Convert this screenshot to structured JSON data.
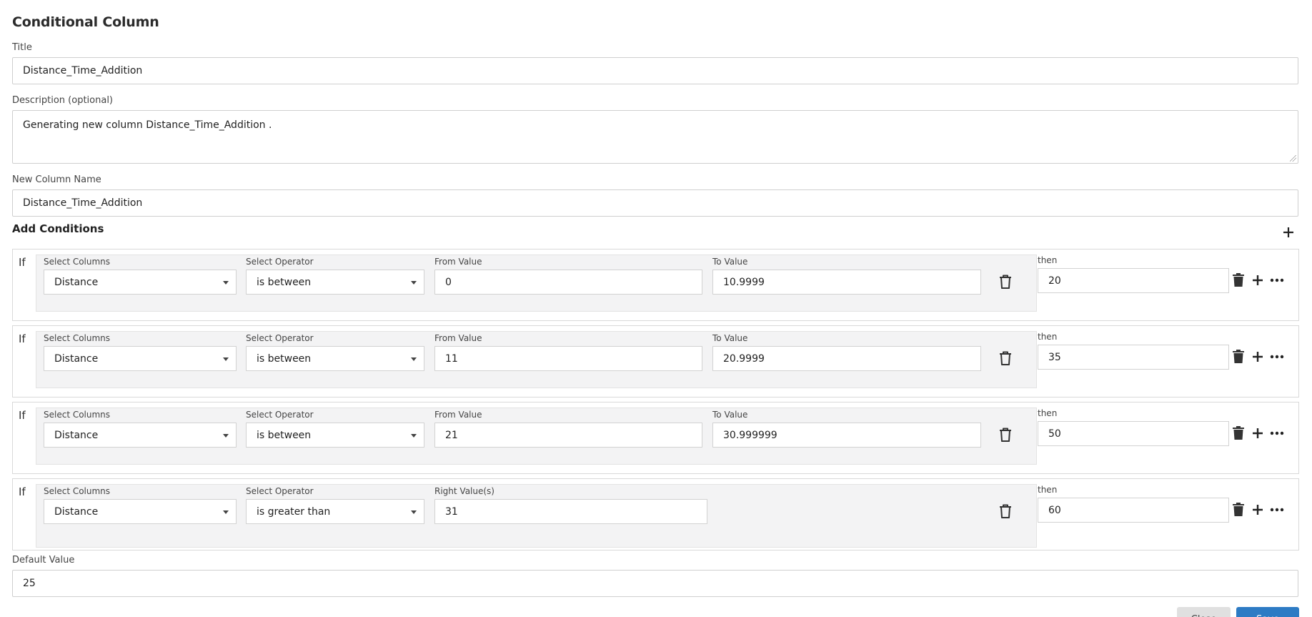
{
  "dialog": {
    "title": "Conditional Column",
    "title_label": "Title",
    "title_value": "Distance_Time_Addition",
    "description_label": "Description (optional)",
    "description_value": "Generating new column Distance_Time_Addition .",
    "new_column_label": "New Column Name",
    "new_column_value": "Distance_Time_Addition",
    "add_conditions_label": "Add Conditions",
    "default_value_label": "Default Value",
    "default_value": "25",
    "close_label": "Close",
    "save_label": "Save"
  },
  "conditions": [
    {
      "if_label": "If",
      "select_columns_label": "Select Columns",
      "column": "Distance",
      "select_operator_label": "Select Operator",
      "operator": "is between",
      "from_label": "From Value",
      "from_value": "0",
      "to_label": "To Value",
      "to_value": "10.9999",
      "then_label": "then",
      "then_value": "20"
    },
    {
      "if_label": "If",
      "select_columns_label": "Select Columns",
      "column": "Distance",
      "select_operator_label": "Select Operator",
      "operator": "is between",
      "from_label": "From Value",
      "from_value": "11",
      "to_label": "To Value",
      "to_value": "20.9999",
      "then_label": "then",
      "then_value": "35"
    },
    {
      "if_label": "If",
      "select_columns_label": "Select Columns",
      "column": "Distance",
      "select_operator_label": "Select Operator",
      "operator": "is between",
      "from_label": "From Value",
      "from_value": "21",
      "to_label": "To Value",
      "to_value": "30.999999",
      "then_label": "then",
      "then_value": "50"
    },
    {
      "if_label": "If",
      "select_columns_label": "Select Columns",
      "column": "Distance",
      "select_operator_label": "Select Operator",
      "operator": "is greater than",
      "right_label": "Right Value(s)",
      "right_value": "31",
      "then_label": "then",
      "then_value": "60"
    }
  ],
  "icons": {
    "add": "plus-icon",
    "delete_condition": "trash-outline-icon",
    "delete_row": "trash-solid-icon",
    "more": "ellipsis-icon",
    "dropdown": "caret-down-icon"
  },
  "colors": {
    "primary": "#2d7bc4",
    "panel_bg": "#f3f3f4",
    "border": "#cfcfcf"
  }
}
